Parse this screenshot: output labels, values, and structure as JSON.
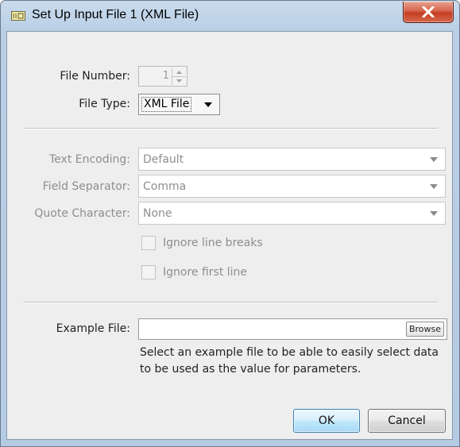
{
  "window": {
    "title": "Set Up Input File 1 (XML File)",
    "icon": "input-file-icon",
    "close_icon": "close-icon",
    "close_color": "#c43e22"
  },
  "form": {
    "file_number_label": "File Number:",
    "file_number_value": "1",
    "file_type_label": "File Type:",
    "file_type_value": "XML File",
    "text_encoding_label": "Text Encoding:",
    "text_encoding_value": "Default",
    "field_separator_label": "Field Separator:",
    "field_separator_value": "Comma",
    "quote_character_label": "Quote Character:",
    "quote_character_value": "None",
    "ignore_line_breaks_label": "Ignore line breaks",
    "ignore_first_line_label": "Ignore first line",
    "example_file_label": "Example File:",
    "example_file_value": "",
    "browse_label": "Browse",
    "help_text": "Select an example file to be able to easily select data to be used as the value for parameters."
  },
  "buttons": {
    "ok_label": "OK",
    "cancel_label": "Cancel"
  }
}
